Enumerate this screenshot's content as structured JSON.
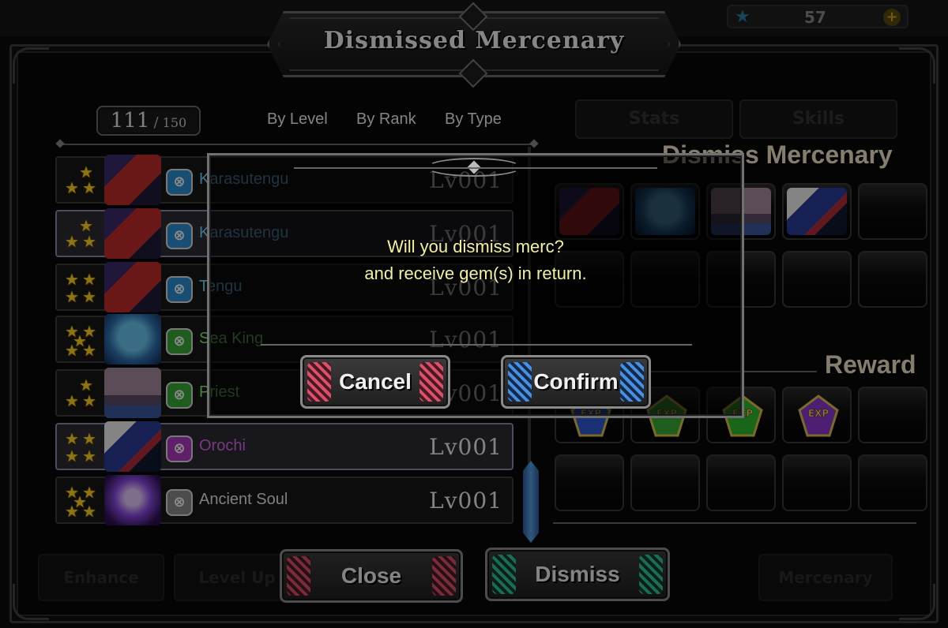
{
  "title": "Dismissed Mercenary",
  "top_bar": {
    "gem_count": "57",
    "gem_plus": "+"
  },
  "counter": {
    "current": "111",
    "separator": "/",
    "max": "150"
  },
  "sort": {
    "by_level": "By Level",
    "by_rank": "By Rank",
    "by_type": "By Type"
  },
  "mercenaries": [
    {
      "name": "Karasutengu",
      "level": "Lv001",
      "stars": 3,
      "type_color": "#2f8fd4",
      "name_color": "#7fd0ff",
      "portrait": "red-tengu",
      "selected": false
    },
    {
      "name": "Karasutengu",
      "level": "Lv001",
      "stars": 3,
      "type_color": "#2f8fd4",
      "name_color": "#7fd0ff",
      "portrait": "red-tengu",
      "selected": true
    },
    {
      "name": "Tengu",
      "level": "Lv001",
      "stars": 4,
      "type_color": "#2f8fd4",
      "name_color": "#7fd0ff",
      "portrait": "red-tengu",
      "selected": false
    },
    {
      "name": "Sea King",
      "level": "Lv001",
      "stars": 5,
      "type_color": "#3aaa3a",
      "name_color": "#8ee67a",
      "portrait": "sea-king",
      "selected": false
    },
    {
      "name": "Priest",
      "level": "Lv001",
      "stars": 3,
      "type_color": "#3aaa3a",
      "name_color": "#8ee67a",
      "portrait": "priest",
      "selected": false
    },
    {
      "name": "Orochi",
      "level": "Lv001",
      "stars": 4,
      "type_color": "#b03ac0",
      "name_color": "#d96ae8",
      "portrait": "orochi",
      "selected": true
    },
    {
      "name": "Ancient Soul",
      "level": "Lv001",
      "stars": 5,
      "type_color": "#8a8a8a",
      "name_color": "#e6e6e6",
      "portrait": "ancient-soul",
      "selected": false
    }
  ],
  "right_panel": {
    "dismiss_title": "Dismiss Mercenary",
    "reward_title": "Reward",
    "tab_stats": "Stats",
    "tab_skills": "Skills",
    "exp_label": "EXP"
  },
  "dialog": {
    "line1": "Will you dismiss merc?",
    "line2": "and receive gem(s) in return.",
    "cancel": "Cancel",
    "confirm": "Confirm"
  },
  "buttons": {
    "close": "Close",
    "dismiss": "Dismiss",
    "enhance": "Enhance",
    "level_up": "Level Up",
    "mercenary": "Mercenary"
  },
  "colors": {
    "star": "#ffd42a",
    "message": "#f2f0a8",
    "section_title": "#f2e3c6"
  }
}
